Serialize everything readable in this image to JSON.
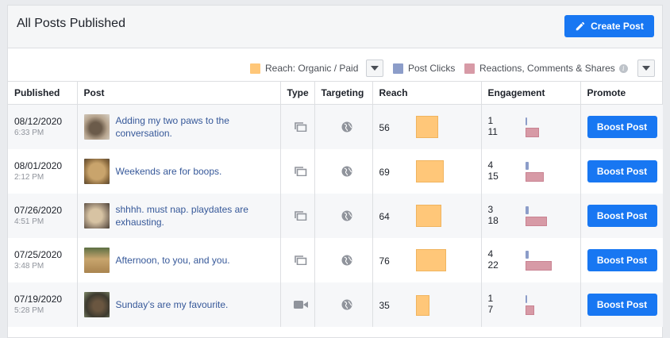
{
  "header": {
    "title": "All Posts Published",
    "create_post_label": "Create Post"
  },
  "legend": [
    {
      "label": "Reach: Organic / Paid",
      "color": "#ffc779"
    },
    {
      "label": "Post Clicks",
      "color": "#8c9dc9"
    },
    {
      "label": "Reactions, Comments & Shares",
      "color": "#d79aa6"
    }
  ],
  "columns": [
    "Published",
    "Post",
    "Type",
    "Targeting",
    "Reach",
    "Engagement",
    "Promote"
  ],
  "rows": [
    {
      "date": "08/12/2020",
      "time": "6:33 PM",
      "post": "Adding my two paws to the conversation.",
      "type": "photo-icon",
      "reach": "56",
      "clicks": "1",
      "reactions": "11",
      "boost": "Boost Post"
    },
    {
      "date": "08/01/2020",
      "time": "2:12 PM",
      "post": "Weekends are for boops.",
      "type": "photo-icon",
      "reach": "69",
      "clicks": "4",
      "reactions": "15",
      "boost": "Boost Post"
    },
    {
      "date": "07/26/2020",
      "time": "4:51 PM",
      "post": "shhhh. must nap. playdates are exhausting.",
      "type": "photo-icon",
      "reach": "64",
      "clicks": "3",
      "reactions": "18",
      "boost": "Boost Post"
    },
    {
      "date": "07/25/2020",
      "time": "3:48 PM",
      "post": "Afternoon, to you, and you.",
      "type": "photo-icon",
      "reach": "76",
      "clicks": "4",
      "reactions": "22",
      "boost": "Boost Post"
    },
    {
      "date": "07/19/2020",
      "time": "5:28 PM",
      "post": "Sunday’s are my favourite.",
      "type": "video-icon",
      "reach": "35",
      "clicks": "1",
      "reactions": "7",
      "boost": "Boost Post"
    }
  ]
}
